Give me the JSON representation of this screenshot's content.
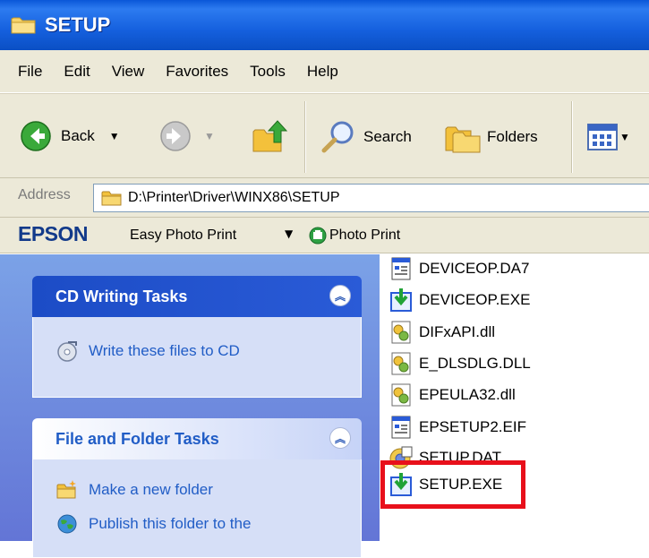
{
  "window": {
    "title": "SETUP"
  },
  "menu": [
    "File",
    "Edit",
    "View",
    "Favorites",
    "Tools",
    "Help"
  ],
  "toolbar": {
    "back_label": "Back",
    "search_label": "Search",
    "folders_label": "Folders"
  },
  "address": {
    "label": "Address",
    "path": "D:\\Printer\\Driver\\WINX86\\SETUP"
  },
  "epson": {
    "logo": "EPSON",
    "easy_photo_print": "Easy Photo Print",
    "photo_print": "Photo Print"
  },
  "tasks": {
    "cd_writing": {
      "title": "CD Writing Tasks",
      "items": [
        "Write these files to CD"
      ]
    },
    "file_folder": {
      "title": "File and Folder Tasks",
      "items": [
        "Make a new folder",
        "Publish this folder to the"
      ]
    }
  },
  "files": [
    {
      "name": "DEVICEOP.DA7",
      "icon": "data-file-icon"
    },
    {
      "name": "DEVICEOP.EXE",
      "icon": "installer-exe-icon"
    },
    {
      "name": "DIFxAPI.dll",
      "icon": "dll-file-icon"
    },
    {
      "name": "E_DLSDLG.DLL",
      "icon": "dll-file-icon"
    },
    {
      "name": "EPEULA32.dll",
      "icon": "dll-file-icon"
    },
    {
      "name": "EPSETUP2.EIF",
      "icon": "data-file-icon"
    },
    {
      "name": "SETUP.DAT",
      "icon": "dat-file-icon"
    },
    {
      "name": "SETUP.EXE",
      "icon": "installer-exe-icon"
    }
  ],
  "colors": {
    "title_bar": "#1560de",
    "task_pane": "#6f8ddf",
    "highlight": "#e8101b",
    "task_link": "#215dc6"
  }
}
